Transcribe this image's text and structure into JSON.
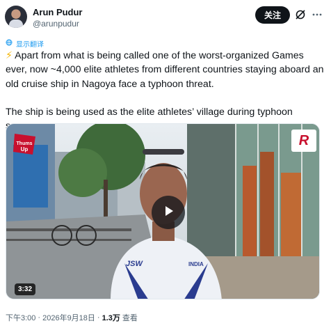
{
  "author": {
    "name": "Arun Pudur",
    "handle": "@arunpudur"
  },
  "actions": {
    "follow_label": "关注",
    "grok_icon": "grok-icon",
    "more_icon": "more-horizontal-icon"
  },
  "translate": {
    "label": "显示翻译",
    "icon": "globe-icon"
  },
  "tweet": {
    "emoji": "⚡",
    "paragraph1": " Apart from what is being called one of the worst-organized Games ever, now ~4,000 elite athletes from different countries staying aboard an old cruise ship in Nagoya face a typhoon threat.",
    "paragraph2": "The ship is being used as the elite athletes’ village during typhoon season."
  },
  "media": {
    "type": "video",
    "duration": "3:32",
    "play_icon": "play-icon",
    "overlay_texts": {
      "left_logo": "Thums Up",
      "right_logo": "R",
      "shirt_brand": "JSW",
      "shirt_country": "INDIA"
    }
  },
  "meta": {
    "time": "下午3:00",
    "separator": "·",
    "date": "2026年9月18日",
    "views_count": "1.3万",
    "views_label": "查看"
  },
  "colors": {
    "accent": "#1d9bf0",
    "text": "#0f1419",
    "secondary": "#536471"
  }
}
